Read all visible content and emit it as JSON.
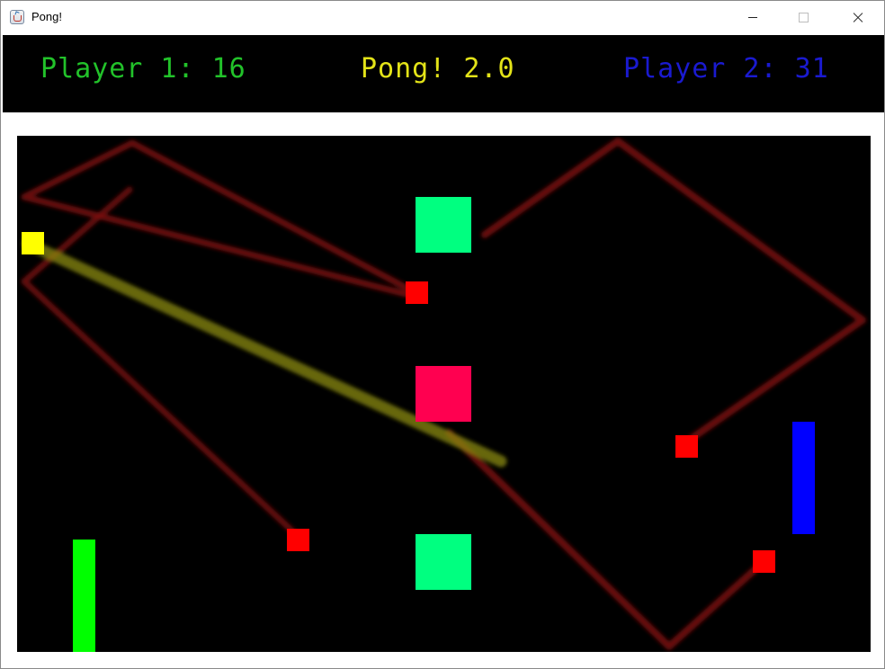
{
  "window": {
    "title": "Pong!",
    "icon": "java-cup-icon",
    "controls": [
      "minimize-icon",
      "maximize-icon",
      "close-icon"
    ]
  },
  "scoreboard": {
    "player1": {
      "label": "Player 1: 16",
      "score": 16,
      "color": "#22c22a"
    },
    "title": {
      "label": "Pong! 2.0",
      "color": "#e3e318"
    },
    "player2": {
      "label": "Player 2: 31",
      "score": 31,
      "color": "#1a1ad0"
    }
  },
  "game": {
    "background": "#000000",
    "colors": {
      "ball": "#ffff00",
      "player1_paddle": "#00ff00",
      "player2_paddle": "#0000ff",
      "obstacle_green": "#00ff80",
      "obstacle_pink": "#ff0050",
      "bouncer_red": "#ff0000",
      "trail_red": "#7a0a0a",
      "trail_yellow": "#8a8a10"
    }
  }
}
